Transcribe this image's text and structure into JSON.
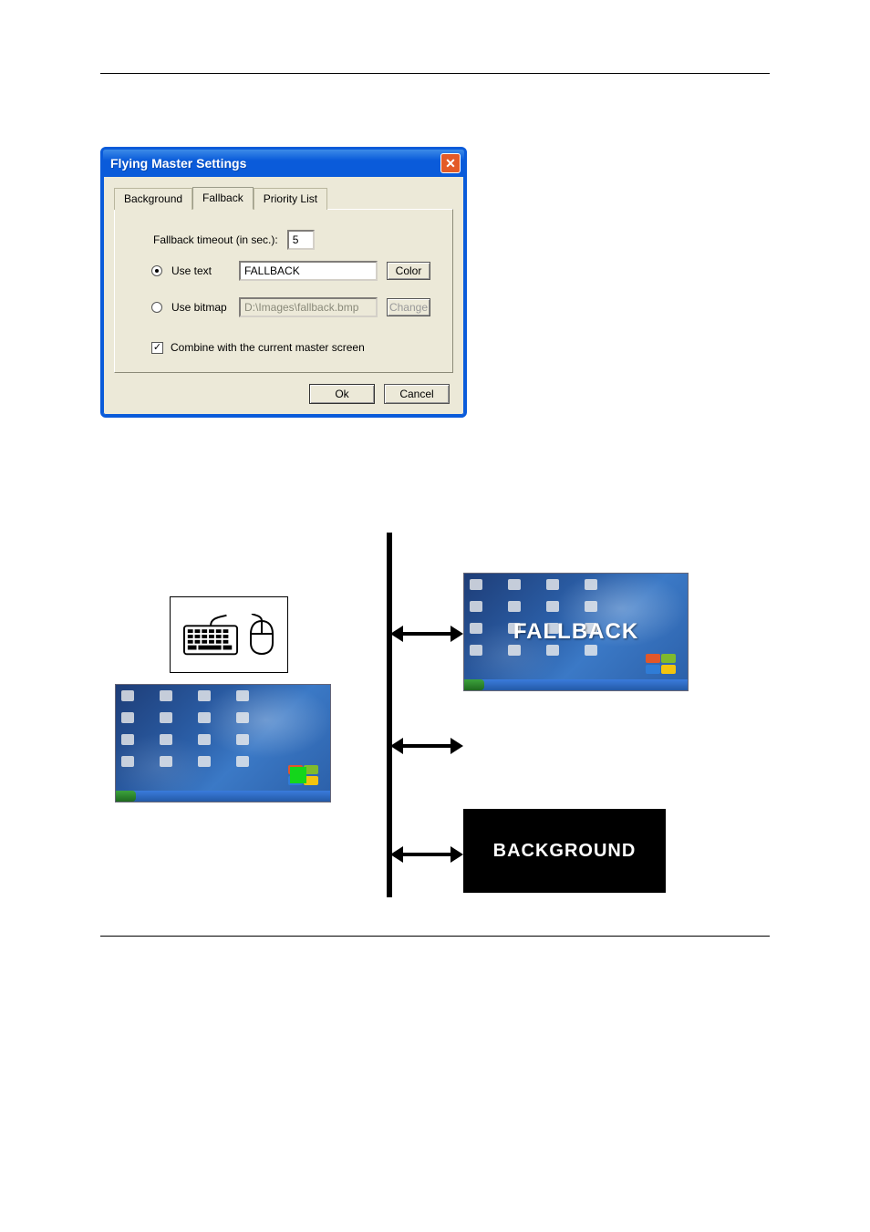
{
  "dialog": {
    "title": "Flying Master Settings",
    "tabs": [
      "Background",
      "Fallback",
      "Priority List"
    ],
    "active_tab_index": 1,
    "timeout_label": "Fallback timeout (in sec.):",
    "timeout_value": "5",
    "useText": {
      "label": "Use text",
      "value": "FALLBACK",
      "button": "Color",
      "selected": true
    },
    "useBitmap": {
      "label": "Use bitmap",
      "value": "D:\\Images\\fallback.bmp",
      "button": "Change",
      "selected": false
    },
    "combine": {
      "label": "Combine with the current master screen",
      "checked": true
    },
    "buttons": {
      "ok": "Ok",
      "cancel": "Cancel"
    }
  },
  "diagram": {
    "fallback_overlay": "FALLBACK",
    "background_box": "BACKGROUND"
  }
}
